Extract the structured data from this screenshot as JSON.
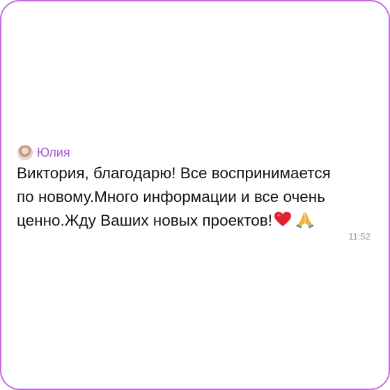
{
  "message": {
    "sender": "Юлия",
    "lines": [
      "Виктория, благодарю! Все  воспринимается",
      "по новому.Много информации и  все очень",
      "ценно.Жду Ваших новых проектов!"
    ],
    "emojis": [
      "heart-emoji",
      "praying-hands-emoji"
    ],
    "time": "11:52"
  },
  "colors": {
    "frame_border": "#c26be0",
    "sender_name": "#a15bd0",
    "text": "#141414",
    "time": "#9b9b9b"
  }
}
